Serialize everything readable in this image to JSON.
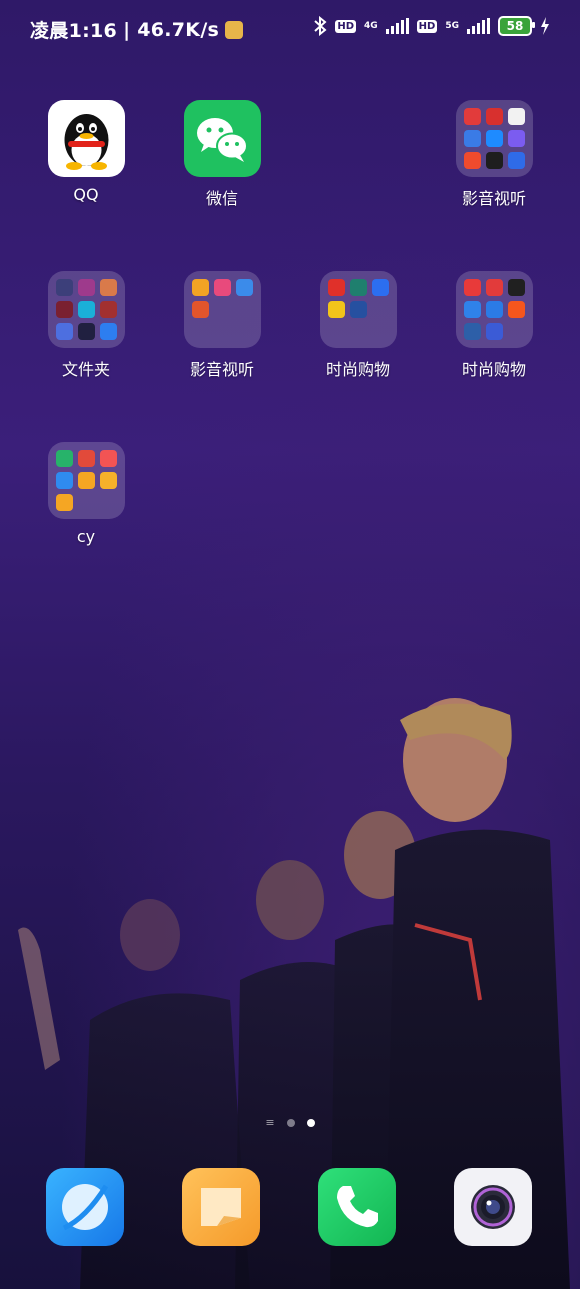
{
  "status_bar": {
    "time": "凌晨1:16",
    "speed": "| 46.7K/s",
    "hd1": "HD",
    "net1": "4G",
    "hd2": "HD",
    "net2": "5G",
    "battery": "58"
  },
  "apps": {
    "qq": "QQ",
    "wechat": "微信",
    "folder_media_1": "影音视听",
    "folder_files": "文件夹",
    "folder_media_2": "影音视听",
    "folder_shopping_1": "时尚购物",
    "folder_shopping_2": "时尚购物",
    "folder_cy": "cy"
  },
  "folder_icons": {
    "media_1": [
      "#e23b3b",
      "#d8302e",
      "#f2f2f2",
      "#3a7be6",
      "#1e8bff",
      "#7b5cf0",
      "#ef4b2d",
      "#1e1e1e",
      "#2f6be8"
    ],
    "files": [
      "#3c3f7a",
      "#9e3a8c",
      "#d97a4a",
      "#7a2030",
      "#1ab0d8",
      "#a23030",
      "#4d6fe0",
      "#202040",
      "#2d7ef0"
    ],
    "media_2": [
      "#f2a324",
      "#e84a7c",
      "#3b8bea",
      "#e2552c"
    ],
    "shopping_1": [
      "#e0302a",
      "#1f7f6e",
      "#2c6ef0",
      "#f2c41a",
      "#2650a0"
    ],
    "shopping_2": [
      "#e83a3a",
      "#e23b3b",
      "#202020",
      "#2f82ea",
      "#2b7be6",
      "#f5561d",
      "#2d5fa8",
      "#3b5bd6"
    ],
    "cy": [
      "#27b36a",
      "#e24a3a",
      "#f25454",
      "#2f8bf0",
      "#f5a623",
      "#f5b12a",
      "#f5a623"
    ]
  },
  "colors": {
    "qq_bg": "#ffffff",
    "wechat_bg": "#1fc160",
    "browser": "#1e8df0",
    "notes": "#f6a53a",
    "phone": "#1fc460",
    "camera_bg": "#f2f2f6"
  }
}
